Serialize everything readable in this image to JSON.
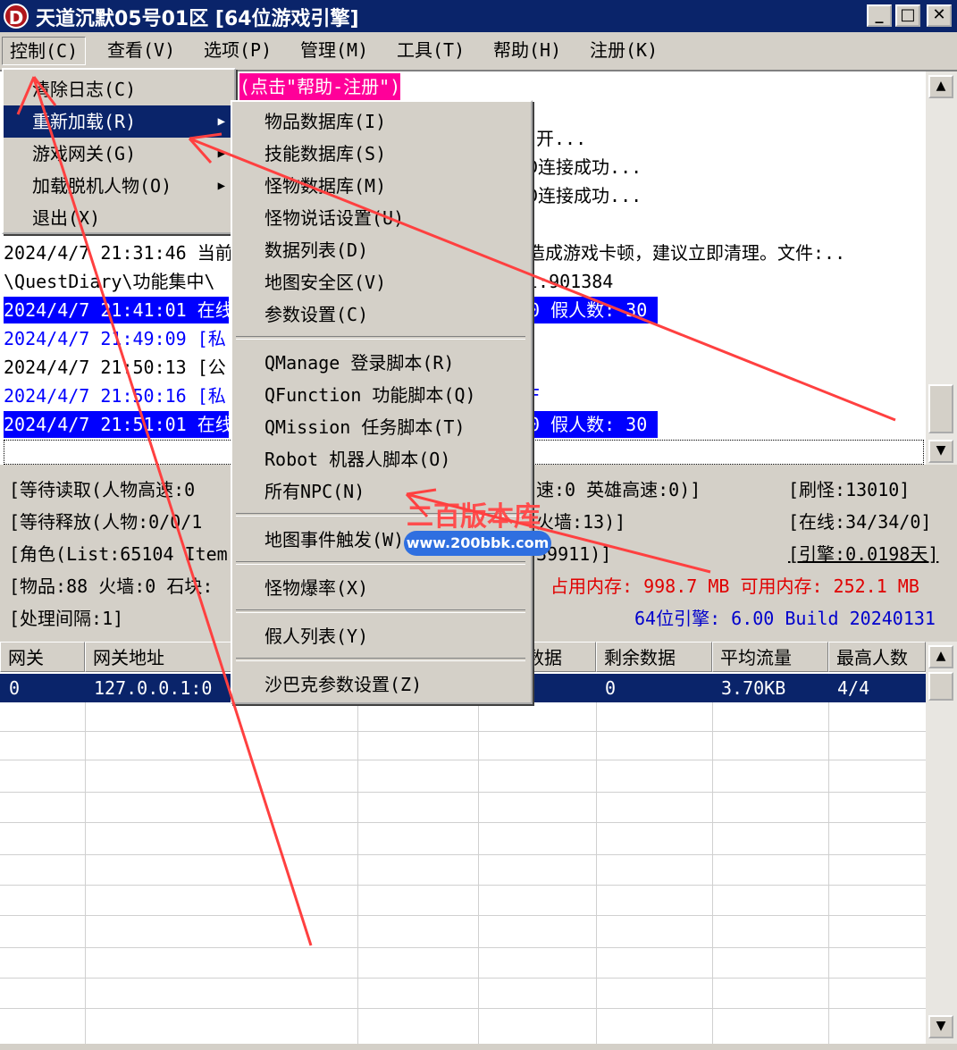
{
  "window": {
    "title": "天道沉默05号01区 [64位游戏引擎]",
    "icon_letter": "D",
    "min": "_",
    "max": "□",
    "close": "✕"
  },
  "menubar": [
    "控制(C)",
    "查看(V)",
    "选项(P)",
    "管理(M)",
    "工具(T)",
    "帮助(H)",
    "注册(K)"
  ],
  "control_menu": {
    "items": [
      "清除日志(C)",
      "重新加载(R)",
      "游戏网关(G)",
      "加载脱机人物(O)",
      "退出(X)"
    ],
    "submenu_arrow": "▶"
  },
  "reload_menu": {
    "group1": [
      "物品数据库(I)",
      "技能数据库(S)",
      "怪物数据库(M)",
      "怪物说话设置(U)",
      "数据列表(D)",
      "地图安全区(V)",
      "参数设置(C)"
    ],
    "group2": [
      "QManage 登录脚本(R)",
      "QFunction 功能脚本(Q)",
      "QMission 任务脚本(T)",
      "Robot 机器人脚本(O)",
      "所有NPC(N)"
    ],
    "group3": [
      "地图事件触发(W)"
    ],
    "group4": [
      "怪物爆率(X)"
    ],
    "group5": [
      "假人列表(Y)"
    ],
    "group6": [
      "沙巴克参数设置(Z)"
    ]
  },
  "log": {
    "banner": "(点击\"帮助-注册\")",
    "r1": "开...",
    "r2": "D连接成功...",
    "r3": "D连接成功...",
    "l1a": "2024/4/7 21:31:46 当前",
    "l1b": "造成游戏卡顿，建议立即清理。文件:..",
    "l2a": "\\QuestDiary\\功能集中\\",
    "l2b": "l:901384",
    "l3a": "2024/4/7 21:41:01 在线",
    "l3b": "0 假人数: 30",
    "l4a": "2024/4/7 21:49:09 [私",
    "l5a": "2024/4/7 21:50:13 [公",
    "l6a": "2024/4/7 21:50:16 [私",
    "l6b": "F",
    "l7a": "2024/4/7 21:51:01 在线",
    "l7b": "0 假人数: 30"
  },
  "stats": {
    "s1a": "[等待读取(人物高速:0",
    "s1b": "速:0 英雄高速:0)]",
    "s1c": "[刷怪:13010]",
    "s2a": "[等待释放(人物:0/0/1",
    "s2b": "火墙:13)]",
    "s2c": "[在线:34/34/0]",
    "s3a": "[角色(List:65104 Item",
    "s3b": "39911)]",
    "s3c": "[引擎:0.0198天]",
    "s4a": "[物品:88 火墙:0 石块:",
    "s4b": "占用内存: 998.7 MB 可用内存: 252.1 MB",
    "s5a": "[处理间隔:1]",
    "s5b": "64位引擎: 6.00 Build 20240131"
  },
  "grid": {
    "headers": [
      "网关",
      "网关地址",
      "",
      "",
      "数据",
      "剩余数据",
      "平均流量",
      "最高人数"
    ],
    "row": [
      "0",
      "127.0.0.1:0",
      "",
      "",
      "",
      "0",
      "3.70KB",
      "4/4"
    ]
  },
  "watermark": {
    "text": "二百版本库",
    "url": "www.200bbk.com"
  },
  "colors": {
    "title_bar": "#0a246a",
    "selection": "#0000ff",
    "annotation_arrow": "#ff4040",
    "memory_text": "#e00000"
  }
}
